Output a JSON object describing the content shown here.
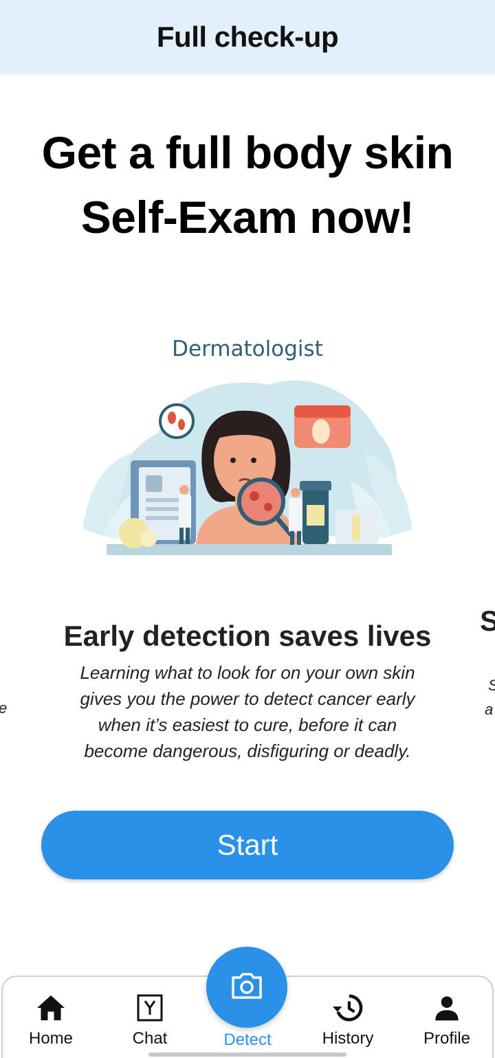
{
  "appbar": {
    "title": "Full check-up"
  },
  "headline": {
    "line1": "Get a full body skin",
    "line2": "Self-Exam now!"
  },
  "illustration": {
    "caption": "Dermatologist"
  },
  "slide": {
    "title": "Early detection saves lives",
    "body": [
      "Learning what to look for on your own skin",
      "gives you the power to detect cancer early",
      "when it’s easiest to cure, before it can",
      "become dangerous, disfiguring or deadly."
    ]
  },
  "peek": {
    "left_char": "e",
    "right_title_char": "S",
    "right_line1": "S",
    "right_line2": "a"
  },
  "start_button": {
    "label": "Start"
  },
  "bottom_nav": {
    "items": [
      {
        "label": "Home",
        "icon": "home-icon"
      },
      {
        "label": "Chat",
        "icon": "chat-icon"
      },
      {
        "label": "Detect",
        "icon": "camera-icon"
      },
      {
        "label": "History",
        "icon": "history-icon"
      },
      {
        "label": "Profile",
        "icon": "person-icon"
      }
    ],
    "active": "Detect",
    "colors": {
      "accent": "#2b91e8",
      "appbar_bg": "#e3f0fb"
    }
  }
}
